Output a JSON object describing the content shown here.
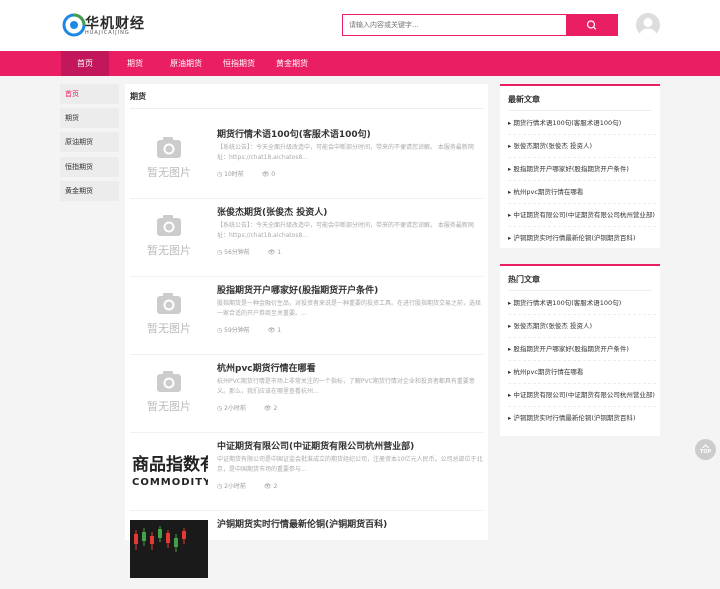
{
  "brand": {
    "name_cn": "华机财经",
    "name_en": "HUAJICAIJING"
  },
  "search": {
    "placeholder": "请输入内容或关键字..."
  },
  "nav": {
    "items": [
      "首页",
      "期货",
      "原油期货",
      "恒指期货",
      "黄金期货"
    ]
  },
  "sidebar": {
    "items": [
      "首页",
      "期货",
      "原油期货",
      "恒指期货",
      "黄金期货"
    ]
  },
  "main": {
    "title": "期货",
    "no_image_text": "暂无图片",
    "articles": [
      {
        "title": "期货行情术语100句(客服术语100句)",
        "excerpt": "【系统公告】：今天全面升级改造中，可能会中断部分时间，带来的不便请您谅解。 本服务最新网址：https://chat18.aichatos8...",
        "time": "10时前",
        "views": "0",
        "thumb": "none"
      },
      {
        "title": "张俊杰期货(张俊杰 投资人)",
        "excerpt": "【系统公告】：今天全面升级改造中，可能会中断部分时间，带来的不便请您谅解。 本服务最新网址：https://chat18.aichatos8...",
        "time": "56分钟前",
        "views": "1",
        "thumb": "none"
      },
      {
        "title": "股指期货开户哪家好(股指期货开户条件)",
        "excerpt": "股指期货是一种金融衍生品，对投资者来说是一种重要的投资工具。在进行股指期货交易之前，选择一家合适的开户券商至关重要。...",
        "time": "59分钟前",
        "views": "1",
        "thumb": "none"
      },
      {
        "title": "杭州pvc期货行情在哪看",
        "excerpt": "杭州PVC期货行情是市场上非常关注的一个指标，了解PVC期货行情对企业和投资者都具有重要意义。那么，我们应该在哪里查看杭州...",
        "time": "2小时前",
        "views": "2",
        "thumb": "none"
      },
      {
        "title": "中证期货有限公司(中证期货有限公司杭州营业部)",
        "excerpt": "中证期货有限公司是中国证监会批准成立的期货经纪公司，注册资本10亿元人民币。公司总部位于北京，是中国期货市场的重要参与...",
        "time": "2小时前",
        "views": "2",
        "thumb": "commodity",
        "thumb_text_1": "商品指数有",
        "thumb_text_2": "COMMODITY IN"
      },
      {
        "title": "沪铜期货实时行情最新伦铜(沪铜期货百科)",
        "excerpt": "",
        "time": "",
        "views": "",
        "thumb": "chart"
      }
    ]
  },
  "latest": {
    "title": "最新文章",
    "items": [
      "期货行情术语100句(客服术语100句)",
      "张俊杰期货(张俊杰 投资人)",
      "股指期货开户哪家好(股指期货开户条件)",
      "杭州pvc期货行情在哪看",
      "中证期货有限公司(中证期货有限公司杭州营业部)",
      "沪铜期货实时行情最新伦铜(沪铜期货百科)"
    ]
  },
  "hot": {
    "title": "热门文章",
    "items": [
      "期货行情术语100句(客服术语100句)",
      "张俊杰期货(张俊杰 投资人)",
      "股指期货开户哪家好(股指期货开户条件)",
      "杭州pvc期货行情在哪看",
      "中证期货有限公司(中证期货有限公司杭州营业部)",
      "沪铜期货实时行情最新伦铜(沪铜期货百科)"
    ]
  },
  "top_button": {
    "label": "TOP"
  },
  "colors": {
    "accent": "#e91e63",
    "accent_dark": "#c2185b"
  }
}
